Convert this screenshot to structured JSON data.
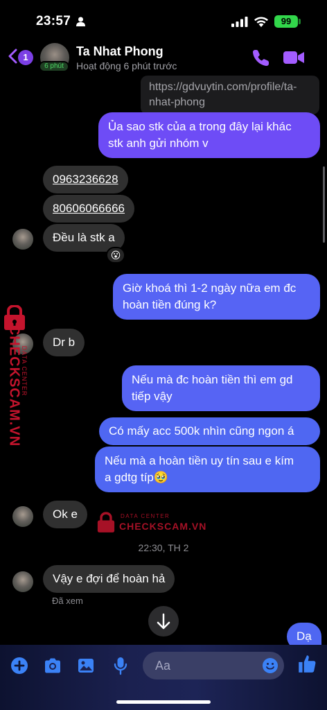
{
  "status_bar": {
    "time": "23:57",
    "battery": "99"
  },
  "header": {
    "back_badge": "1",
    "avatar_pill": "6 phút",
    "name": "Ta Nhat Phong",
    "status": "Hoạt động 6 phút trước"
  },
  "messages": {
    "link_line1": "https://gdvuytin.com/profile/ta-",
    "link_line2": "nhat-phong",
    "out1_line1": "Ủa sao stk của a trong đây lại khác",
    "out1_line2": "stk anh gửi nhóm v",
    "in1": "0963236628",
    "in2": "80606066666",
    "in3": "Đều là stk a",
    "reaction": "😮",
    "out2_line1": "Giờ khoá thì 1-2 ngày nữa em đc",
    "out2_line2": "hoàn tiền đúng k?",
    "in4": "Dr b",
    "out3_line1": "Nếu mà đc hoàn tiền thì em gd",
    "out3_line2": "tiếp vậy",
    "out4": "Có mấy acc 500k nhìn cũng ngon á",
    "out5_line1": "Nếu mà a hoàn tiền uy tín sau e kím",
    "out5_line2": "a gdtg típ🥹",
    "in5": "Ok e",
    "timestamp": "22:30, TH 2",
    "in6": "Vậy e đợi để hoàn hả",
    "seen": "Đã xem",
    "out6": "Dạ"
  },
  "watermark": {
    "top": "DATA CENTER",
    "brand": "CHECKSCAM.VN"
  },
  "composer": {
    "placeholder": "Aa"
  },
  "colors": {
    "accent": "#a35cff",
    "outgoing": "#6e4cf6",
    "incoming": "#303030"
  }
}
